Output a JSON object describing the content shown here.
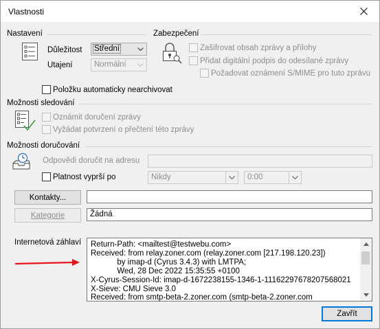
{
  "window": {
    "title": "Vlastnosti"
  },
  "settings": {
    "group_label": "Nastavení",
    "importance_label": "Důležitost",
    "importance_value": "Střední",
    "sensitivity_label": "Utajení",
    "sensitivity_value": "Normální",
    "autoarchive_label": "Položku automaticky nearchivovat"
  },
  "security": {
    "group_label": "Zabezpečení",
    "encrypt_label": "Zašifrovat obsah zprávy a přílohy",
    "sign_label": "Přidat digitální podpis do odesílané zprávy",
    "smime_label": "Požadovat oznámení S/MIME pro tuto zprávu"
  },
  "tracking": {
    "group_label": "Možnosti sledování",
    "delivery_label": "Oznámit doručení zprávy",
    "read_label": "Vyžádat potvrzení o přečtení této zprávy"
  },
  "delivery": {
    "group_label": "Možnosti doručování",
    "replies_label": "Odpovědi doručit na adresu",
    "expires_label": "Platnost vyprší po",
    "expires_date": "Nikdy",
    "expires_time": "0:00"
  },
  "contacts": {
    "button_label": "Kontakty...",
    "value": ""
  },
  "categories": {
    "button_label": "Kategorie",
    "value": "Žádná"
  },
  "internet_headers": {
    "label": "Internetová záhlaví",
    "lines": [
      "Return-Path: <mailtest@testwebu.com>",
      "Received: from relay.zoner.com (relay.zoner.com [217.198.120.23])",
      "            by imap-d (Cyrus 3.4.3) with LMTPA;",
      "            Wed, 28 Dec 2022 15:35:55 +0100",
      "X-Cyrus-Session-Id: imap-d-1672238155-1346-1-11162297678207568021",
      "X-Sieve: CMU Sieve 3.0",
      "Received: from smtp-beta-2.zoner.com (smtp-beta-2.zoner.com"
    ]
  },
  "footer": {
    "close_label": "Zavřít"
  },
  "colors": {
    "accent": "#0078d7",
    "annotation_arrow": "#e8141b"
  },
  "icons": [
    "close-icon",
    "settings-list-icon",
    "padlock-icon",
    "tracking-icon",
    "delivery-tray-icon",
    "chevron-down-icon",
    "scroll-up-icon",
    "scroll-down-icon",
    "red-arrow-icon"
  ]
}
